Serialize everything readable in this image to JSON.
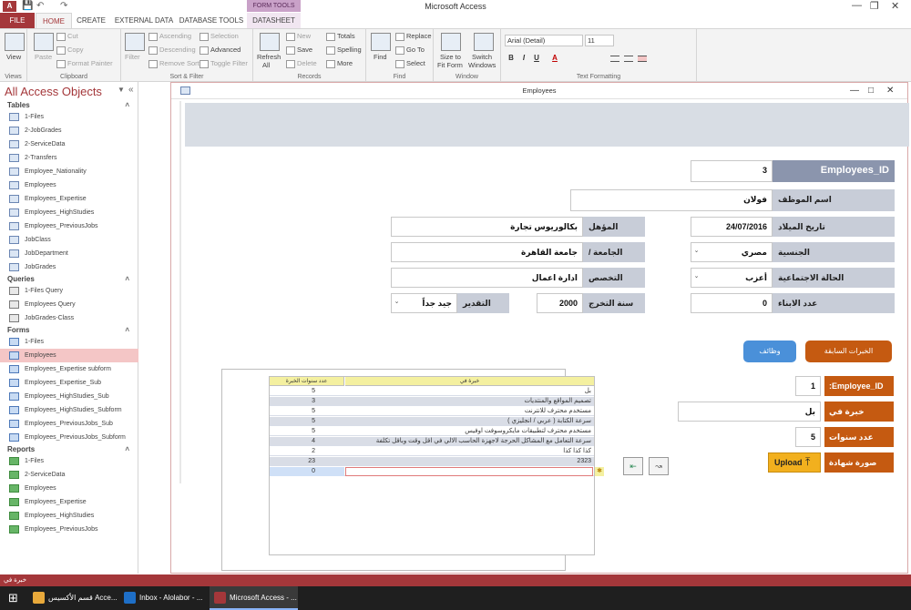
{
  "app": {
    "title": "Microsoft Access",
    "icon_text": "A"
  },
  "contextual_tab": "FORM TOOLS",
  "tabs": [
    "FILE",
    "HOME",
    "CREATE",
    "EXTERNAL DATA",
    "DATABASE TOOLS",
    "DATASHEET"
  ],
  "ribbon": {
    "views": {
      "label": "Views",
      "view": "View"
    },
    "clipboard": {
      "label": "Clipboard",
      "paste": "Paste",
      "cut": "Cut",
      "copy": "Copy",
      "format_painter": "Format Painter"
    },
    "sort_filter": {
      "label": "Sort & Filter",
      "filter": "Filter",
      "ascending": "Ascending",
      "descending": "Descending",
      "remove_sort": "Remove Sort",
      "selection": "Selection",
      "advanced": "Advanced",
      "toggle_filter": "Toggle Filter"
    },
    "records": {
      "label": "Records",
      "refresh": "Refresh",
      "refresh2": "All",
      "new": "New",
      "save": "Save",
      "delete": "Delete",
      "totals": "Totals",
      "spelling": "Spelling",
      "more": "More"
    },
    "find": {
      "label": "Find",
      "find": "Find",
      "replace": "Replace",
      "goto": "Go To",
      "select": "Select"
    },
    "window": {
      "label": "Window",
      "size_to_fit": "Size to",
      "size_to_fit2": "Fit Form",
      "switch": "Switch",
      "switch2": "Windows"
    },
    "text_formatting": {
      "label": "Text Formatting",
      "font": "Arial (Detail)",
      "size": "11",
      "bold": "B",
      "italic": "I",
      "underline": "U",
      "font_color": "A"
    }
  },
  "nav": {
    "title": "All Access Objects",
    "sections": [
      {
        "name": "Tables",
        "items": [
          "1-Files",
          "2-JobGrades",
          "2-ServiceData",
          "2-Transfers",
          "Employee_Nationality",
          "Employees",
          "Employees_Expertise",
          "Employees_HighStudies",
          "Employees_PreviousJobs",
          "JobClass",
          "JobDepartment",
          "JobGrades"
        ]
      },
      {
        "name": "Queries",
        "items": [
          "1-Files Query",
          "Employees Query",
          "JobGrades-Class"
        ]
      },
      {
        "name": "Forms",
        "items": [
          "1-Files",
          "Employees",
          "Employees_Expertise subform",
          "Employees_Expertise_Sub",
          "Employees_HighStudies_Sub",
          "Employees_HighStudies_Subform",
          "Employees_PreviousJobs_Sub",
          "Employees_PreviousJobs_Subform"
        ]
      },
      {
        "name": "Reports",
        "items": [
          "1-Files",
          "2-ServiceData",
          "Employees",
          "Employees_Expertise",
          "Employees_HighStudies",
          "Employees_PreviousJobs"
        ]
      }
    ],
    "selected": "Employees"
  },
  "form": {
    "title": "Employees",
    "fields": {
      "employees_id_label": "Employees_ID",
      "employees_id_value": "3",
      "name_label": "اسم الموظف",
      "name_value": "فولان",
      "birth_label": "تاريخ الميلاد",
      "birth_value": "24/07/2016",
      "qualification_label": "المؤهل",
      "qualification_value": "بكالوريوس تجارة",
      "nationality_label": "الجنسية",
      "nationality_value": "مصري",
      "university_label": "الجامعة / المدرسة",
      "university_value": "جامعة القاهرة",
      "marital_label": "الحالة الاجتماعية",
      "marital_value": "أعزب",
      "specialty_label": "التخصص",
      "specialty_value": "ادارة اعمال",
      "children_label": "عدد الابناء",
      "children_value": "0",
      "grad_year_label": "سنة التخرج",
      "grad_year_value": "2000",
      "grade_label": "التقدير",
      "grade_value": "جيد جداً"
    },
    "buttons": {
      "previous_exp": "الخبرات السابقة",
      "jobs": "وظائف",
      "upload": "Upload"
    },
    "expertise": {
      "employee_id_label": "Employee_ID:",
      "employee_id_value": "1",
      "expertise_label": "خبرة في",
      "expertise_value": "بل",
      "years_label": "عدد سنوات الخبرة",
      "years_value": "5",
      "certificate_label": "صورة شهادة الخبرة"
    },
    "datasheet": {
      "columns": [
        "عدد سنوات الخبرة",
        "خبرة في"
      ],
      "rows": [
        {
          "years": "5",
          "exp": "بل"
        },
        {
          "years": "3",
          "exp": "تصميم المواقع والمنتديات"
        },
        {
          "years": "5",
          "exp": "مستخدم محترف للانترنت"
        },
        {
          "years": "5",
          "exp": "سرعة الكتابة ( عربي / انجليزي )"
        },
        {
          "years": "5",
          "exp": "مستخدم محترف لتطبيقات مايكروسوفت اوفيس"
        },
        {
          "years": "4",
          "exp": "سرعة التعامل مع المشاكل الحرجة لاجهزة الحاسب الالي في اقل وقت وبأقل تكلفة"
        },
        {
          "years": "2",
          "exp": "كذا كذا كذا"
        },
        {
          "years": "23",
          "exp": "2323"
        },
        {
          "years": "0",
          "exp": ""
        }
      ]
    }
  },
  "statusbar": {
    "text": "خبرة في"
  },
  "taskbar": [
    {
      "label": "قسم الأكسيس Acce...",
      "color": "#e8a93b"
    },
    {
      "label": "Inbox - Alolabor - ...",
      "color": "#1e6fc7"
    },
    {
      "label": "Microsoft Access - ...",
      "color": "#a4373a"
    }
  ]
}
